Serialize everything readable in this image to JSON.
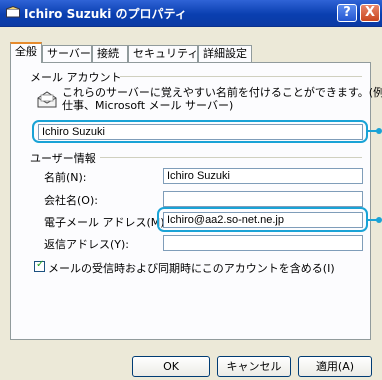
{
  "window": {
    "title": "Ichiro Suzuki のプロパティ",
    "help_label": "?",
    "close_label": "X"
  },
  "tabs": [
    {
      "label": "全般",
      "active": true
    },
    {
      "label": "サーバー",
      "active": false
    },
    {
      "label": "接続",
      "active": false
    },
    {
      "label": "セキュリティ",
      "active": false
    },
    {
      "label": "詳細設定",
      "active": false
    }
  ],
  "mail_account": {
    "group_label": "メール アカウント",
    "description_line1": "これらのサーバーに覚えやすい名前を付けることができます。(例:",
    "description_line2": "仕事、Microsoft メール サーバー)",
    "account_name": "Ichiro Suzuki"
  },
  "user_info": {
    "group_label": "ユーザー情報",
    "name_label": "名前(N):",
    "name_value": "Ichiro Suzuki",
    "company_label": "会社名(O):",
    "company_value": "",
    "email_label": "電子メール アドレス(M):",
    "email_value": "Ichiro@aa2.so-net.ne.jp",
    "reply_label": "返信アドレス(Y):",
    "reply_value": ""
  },
  "include_checkbox": {
    "label": "メールの受信時および同期時にこのアカウントを含める(I)",
    "checked": true
  },
  "buttons": {
    "ok": "OK",
    "cancel": "キャンセル",
    "apply": "適用(A)"
  },
  "colors": {
    "accent": "#1aa3d6",
    "titlebar": "#0a3fb0"
  }
}
